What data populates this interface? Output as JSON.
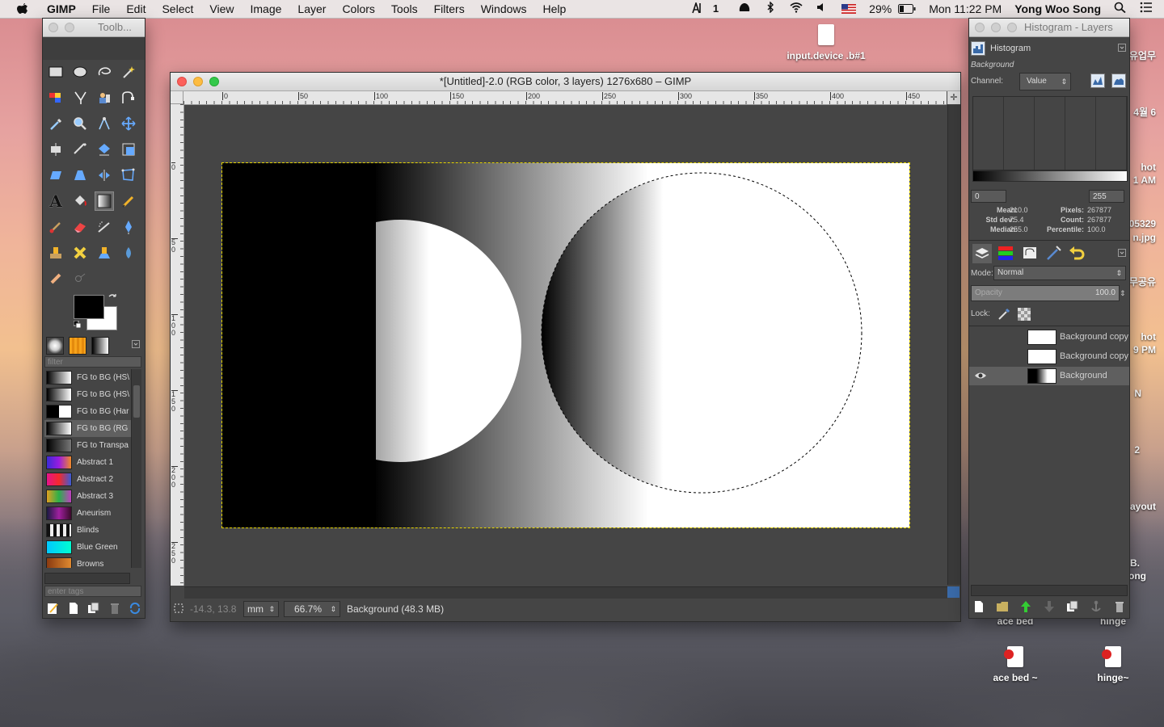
{
  "menubar": {
    "app": "GIMP",
    "items": [
      "File",
      "Edit",
      "Select",
      "View",
      "Image",
      "Layer",
      "Colors",
      "Tools",
      "Filters",
      "Windows",
      "Help"
    ],
    "status": {
      "input_badge": "1",
      "battery": "29%",
      "clock": "Mon 11:22 PM",
      "user": "Yong Woo Song"
    }
  },
  "desktop": {
    "icons": [
      {
        "label": "input.device .b#1"
      },
      {
        "label": "ace bed ~"
      },
      {
        "label": "hinge~"
      }
    ],
    "cut_labels": {
      "under_dock_left": "ace bed",
      "under_dock_right": "hinge"
    },
    "edge_labels": [
      "유업무",
      "4월 6",
      "hot",
      "1 AM",
      "05329",
      "n.jpg",
      "무공유",
      "hot",
      "9 PM",
      "N",
      "2",
      "ayout",
      "B.",
      "ong"
    ]
  },
  "toolbox": {
    "title": "Toolb...",
    "filter_placeholder": "filter",
    "tags_placeholder": "enter tags",
    "gradients": [
      {
        "name": "FG to BG (HS\\",
        "colors": [
          "#000000",
          "#ffffff"
        ]
      },
      {
        "name": "FG to BG (HS\\",
        "colors": [
          "#000000",
          "#ffffff"
        ]
      },
      {
        "name": "FG to BG (Har",
        "colors": [
          "#000000",
          "#ffffff"
        ]
      },
      {
        "name": "FG to BG (RG",
        "colors": [
          "#000000",
          "#ffffff"
        ]
      },
      {
        "name": "FG to Transpa",
        "colors": [
          "#000000",
          "#777777"
        ]
      },
      {
        "name": "Abstract 1",
        "colors": [
          "#3b2bd6",
          "#9a1be0",
          "#f08a2a"
        ]
      },
      {
        "name": "Abstract 2",
        "colors": [
          "#e6148c",
          "#f42a2a",
          "#3b5bd6"
        ]
      },
      {
        "name": "Abstract 3",
        "colors": [
          "#e0a020",
          "#2ab04a",
          "#c040c0"
        ]
      },
      {
        "name": "Aneurism",
        "colors": [
          "#1a1a40",
          "#a020a0",
          "#3a0a2a"
        ]
      },
      {
        "name": "Blinds",
        "colors": [
          "#111111",
          "#eeeeee"
        ]
      },
      {
        "name": "Blue Green",
        "colors": [
          "#00c8ff",
          "#00ffd0"
        ]
      },
      {
        "name": "Browns",
        "colors": [
          "#8a3a10",
          "#e08a30"
        ]
      }
    ]
  },
  "image_window": {
    "title": "*[Untitled]-2.0 (RGB color, 3 layers) 1276x680 – GIMP",
    "ruler_h_ticks": [
      "0",
      "50",
      "100",
      "150",
      "200",
      "250",
      "300",
      "350",
      "400",
      "450"
    ],
    "ruler_v_ticks": [
      "0",
      "50",
      "100",
      "150",
      "200",
      "250"
    ],
    "status": {
      "coords": "-14.3, 13.8",
      "unit": "mm",
      "zoom": "66.7%",
      "layer_info": "Background (48.3 MB)"
    }
  },
  "dock": {
    "title": "Histogram - Layers",
    "histogram": {
      "tab_label": "Histogram",
      "drawable": "Background",
      "channel_label": "Channel:",
      "channel_value": "Value",
      "range_low": "0",
      "range_high": "255",
      "stats": {
        "mean_label": "Mean:",
        "mean": "210.0",
        "stddev_label": "Std dev:",
        "stddev": "75.4",
        "median_label": "Median:",
        "median": "255.0",
        "pixels_label": "Pixels:",
        "pixels": "267877",
        "count_label": "Count:",
        "count": "267877",
        "percentile_label": "Percentile:",
        "percentile": "100.0"
      }
    },
    "layers": {
      "mode_label": "Mode:",
      "mode_value": "Normal",
      "opacity_label": "Opacity",
      "opacity_value": "100.0",
      "lock_label": "Lock:",
      "items": [
        {
          "name": "Background copy",
          "visible": false,
          "selected": false
        },
        {
          "name": "Background copy",
          "visible": false,
          "selected": false
        },
        {
          "name": "Background",
          "visible": true,
          "selected": true
        }
      ]
    }
  }
}
